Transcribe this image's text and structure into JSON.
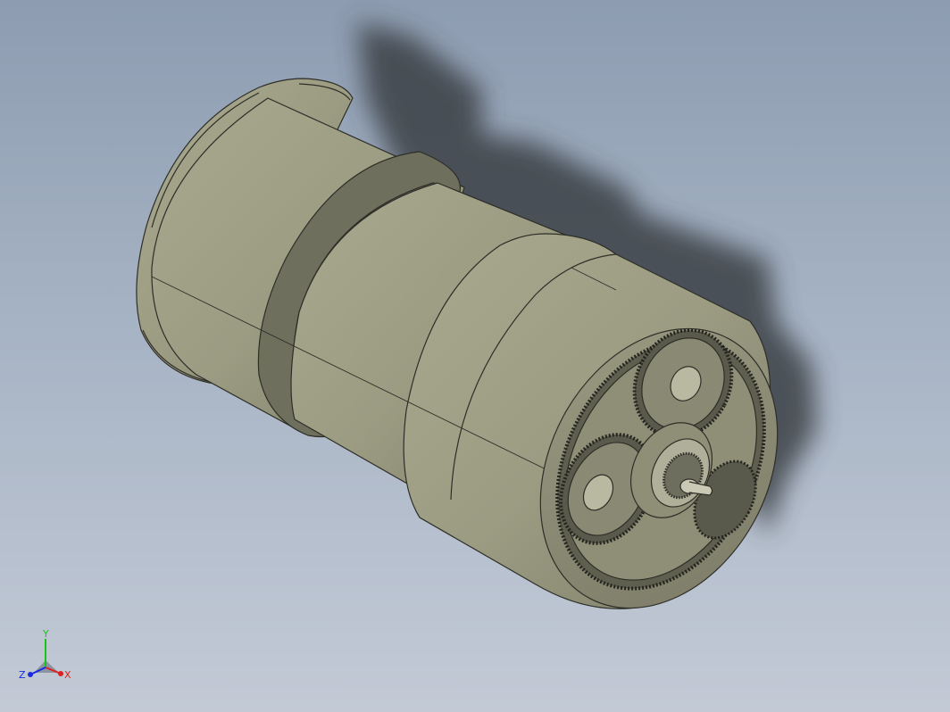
{
  "viewport": {
    "background_top": "#8d9cb1",
    "background_bottom": "#c3cad6",
    "model_color": "#9c9c84",
    "model_shadow_color": "#3d4246",
    "gear_color": "#8a8a74",
    "edge_color": "#2e2e28"
  },
  "triad": {
    "x_label": "X",
    "y_label": "Y",
    "z_label": "Z",
    "x_color": "#e0201c",
    "y_color": "#18c418",
    "z_color": "#1a2ae0"
  }
}
